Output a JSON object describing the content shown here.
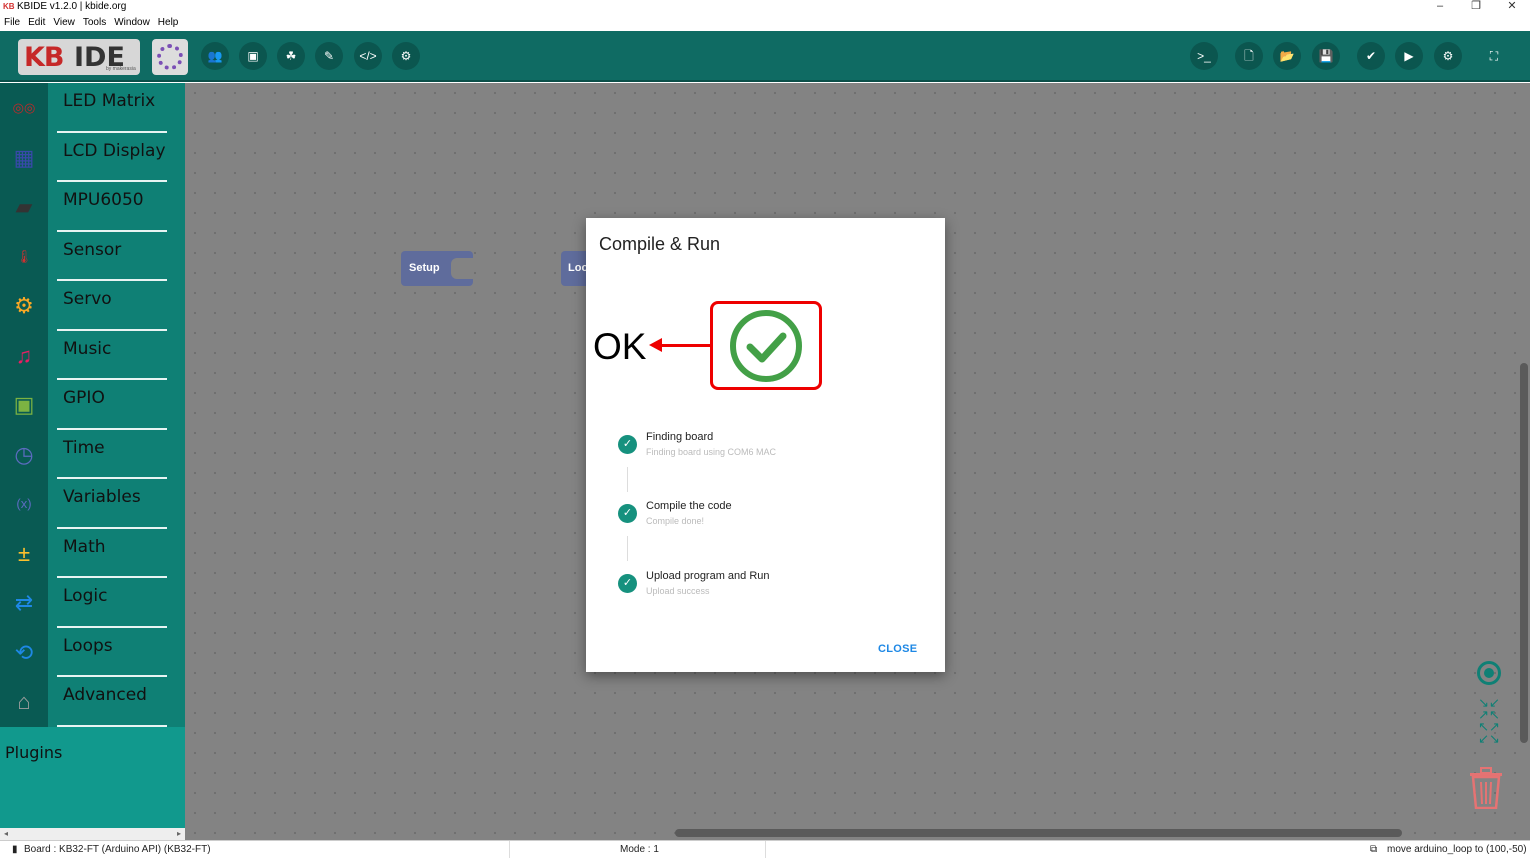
{
  "window": {
    "app_logo": "KB",
    "title": "KBIDE v1.2.0 | kbide.org",
    "controls": [
      "minimize-icon",
      "restore-icon",
      "close-icon"
    ]
  },
  "menu": [
    "File",
    "Edit",
    "View",
    "Tools",
    "Window",
    "Help"
  ],
  "toolbar": {
    "logo_kb": "KB",
    "logo_ide": "IDE",
    "logo_by": "by makerasia",
    "left_buttons": [
      "users-icon",
      "chip-icon",
      "boards-icon",
      "plug-icon",
      "code-icon",
      "gear-icon"
    ],
    "right_buttons": [
      "terminal-icon",
      "new-file-icon",
      "open-folder-icon",
      "save-icon",
      "check-icon",
      "play-icon",
      "settings-icon",
      "fullscreen-icon"
    ]
  },
  "sidebar": {
    "categories": [
      {
        "label": "LED Matrix",
        "icon": "led-matrix-icon",
        "color": "#c62828"
      },
      {
        "label": "LCD Display",
        "icon": "lcd-display-icon",
        "color": "#3949ab"
      },
      {
        "label": "MPU6050",
        "icon": "mpu6050-icon",
        "color": "#333333"
      },
      {
        "label": "Sensor",
        "icon": "thermometer-icon",
        "color": "#d32f2f"
      },
      {
        "label": "Servo",
        "icon": "servo-icon",
        "color": "#f9a825"
      },
      {
        "label": "Music",
        "icon": "music-note-icon",
        "color": "#e91e63"
      },
      {
        "label": "GPIO",
        "icon": "gpio-chip-icon",
        "color": "#7cb342"
      },
      {
        "label": "Time",
        "icon": "clock-icon",
        "color": "#5c6bc0"
      },
      {
        "label": "Variables",
        "icon": "variable-icon",
        "color": "#5c6bc0"
      },
      {
        "label": "Math",
        "icon": "calculator-icon",
        "color": "#fbc02d"
      },
      {
        "label": "Logic",
        "icon": "logic-icon",
        "color": "#1e88e5"
      },
      {
        "label": "Loops",
        "icon": "loop-icon",
        "color": "#1e88e5"
      },
      {
        "label": "Advanced",
        "icon": "advanced-icon",
        "color": "#9e9e9e"
      }
    ],
    "plugins_label": "Plugins"
  },
  "workspace": {
    "blocks": [
      {
        "label": "Setup"
      },
      {
        "label": "Loo"
      }
    ]
  },
  "dialog": {
    "title": "Compile & Run",
    "annotation": "OK",
    "steps": [
      {
        "title": "Finding board",
        "subtitle": "Finding board using COM6 MAC"
      },
      {
        "title": "Compile the code",
        "subtitle": "Compile done!"
      },
      {
        "title": "Upload program and Run",
        "subtitle": "Upload success"
      }
    ],
    "close_label": "CLOSE"
  },
  "status": {
    "board": "Board : KB32-FT (Arduino API) (KB32-FT)",
    "mode": "Mode : 1",
    "message": "move arduino_loop to (100,-50)"
  },
  "colors": {
    "toolbar": "#0f6b63",
    "sidebar": "#0f8075",
    "success": "#16917e",
    "annotation": "#e00000",
    "close": "#1e88e5"
  }
}
